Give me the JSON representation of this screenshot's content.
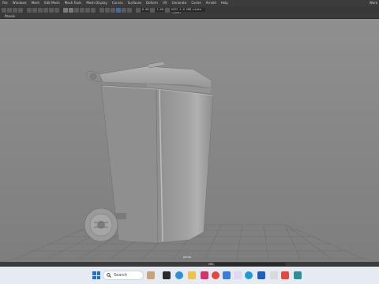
{
  "menus": [
    "File",
    "Windows",
    "Mesh",
    "Edit Mesh",
    "Mesh Tools",
    "Mesh Display",
    "Curves",
    "Surfaces",
    "Deform",
    "UV",
    "Generate",
    "Cache",
    "Arnold",
    "Help"
  ],
  "workspace_label": "Work",
  "toolbar": {
    "field1": "0.00",
    "field2": "1.00",
    "camera_field": "ACES 1.0 SDR-video (sRGB)"
  },
  "panel": {
    "label": "Panels"
  },
  "viewport": {
    "camera_label": "persp"
  },
  "statusbar": {
    "cmd_label": "MEL"
  },
  "taskbar": {
    "search_placeholder": "Search",
    "icons": [
      "weather-icon",
      "task-view-icon",
      "edge-icon",
      "file-explorer-icon",
      "instagram-icon",
      "chrome-icon",
      "mail-icon",
      "photos-icon",
      "edge-alt-icon",
      "store-icon",
      "media-icon",
      "settings-icon",
      "maya-icon"
    ]
  },
  "colors": {
    "viewport_bg": "#8b8b8b",
    "bin_body": "#9a9a9a",
    "grid_line": "#6f6f6f",
    "taskbar_bg": "#e6eaf1",
    "accent": "#1f6fd6"
  }
}
